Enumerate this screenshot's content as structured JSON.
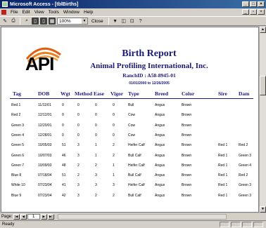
{
  "window": {
    "title": "Microsoft Access - [tblBirths]"
  },
  "menu": [
    "File",
    "Edit",
    "View",
    "Tools",
    "Window",
    "Help"
  ],
  "toolbar": {
    "zoom": "100%",
    "close_label": "Close"
  },
  "report": {
    "logo_text": "API",
    "title": "Birth Report",
    "subtitle": "Animal Profiling International, Inc.",
    "ranch": "RanchID : A58-8945-01",
    "dates": "01/01/2000  to  12/26/2005",
    "columns": [
      "Tag",
      "DOB",
      "Wgt",
      "Method",
      "Ease",
      "Vigor",
      "Type",
      "Breed",
      "Color",
      "Sire",
      "Dam"
    ],
    "rows": [
      [
        "Red 1",
        "11/11/01",
        "0",
        "0",
        "0",
        "0",
        "Bull",
        "Angus",
        "Brown",
        "",
        ""
      ],
      [
        "Red 2",
        "12/12/01",
        "0",
        "0",
        "0",
        "0",
        "Cow",
        "Angus",
        "Brown",
        "",
        ""
      ],
      [
        "Green 3",
        "12/20/01",
        "0",
        "0",
        "0",
        "0",
        "Cow",
        "Angus",
        "Brown",
        "",
        ""
      ],
      [
        "Green 4",
        "12/28/01",
        "0",
        "0",
        "0",
        "0",
        "Cow",
        "Angus",
        "Brown",
        "",
        ""
      ],
      [
        "Green 5",
        "10/05/03",
        "51",
        "3",
        "1",
        "2",
        "Heifer Calf",
        "Angus",
        "Brown",
        "Red 1",
        "Red 2"
      ],
      [
        "Green 6",
        "10/07/03",
        "46",
        "3",
        "1",
        "2",
        "Bull Calf",
        "Angus",
        "Brown",
        "Red 1",
        "Green 3"
      ],
      [
        "Green 7",
        "10/09/03",
        "48",
        "2",
        "2",
        "1",
        "Heifer Calf",
        "Angus",
        "Brown",
        "Red 1",
        "Green 4"
      ],
      [
        "Blue 8",
        "07/18/04",
        "51",
        "2",
        "3",
        "1",
        "Bull Calf",
        "Angus",
        "Brown",
        "Red 1",
        "Red 2"
      ],
      [
        "White 10",
        "07/23/04",
        "41",
        "3",
        "3",
        "3",
        "Heifer Calf",
        "Angus",
        "Brown",
        "Red 1",
        "Green 3"
      ],
      [
        "Blue 9",
        "07/23/04",
        "42",
        "3",
        "2",
        "2",
        "Bull Calf",
        "Angus",
        "Brown",
        "Red 1",
        "Green 3"
      ]
    ]
  },
  "nav": {
    "page_label": "Page:",
    "page": "1"
  },
  "status": {
    "text": "Ready"
  }
}
